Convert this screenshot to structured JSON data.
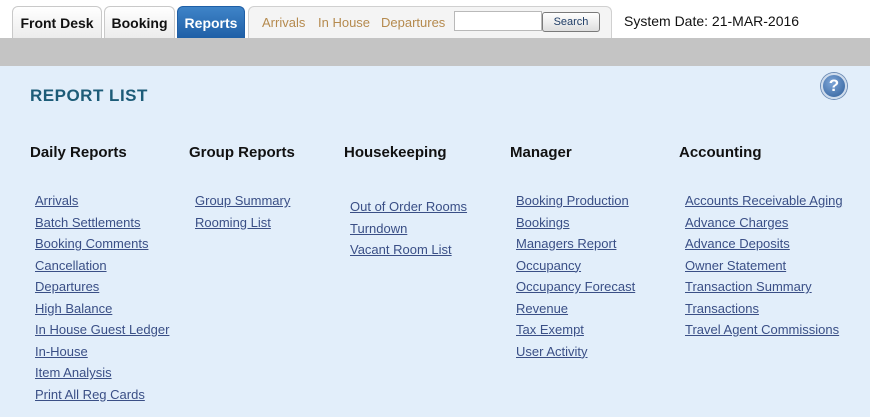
{
  "tabs": [
    {
      "label": "Front Desk",
      "active": false
    },
    {
      "label": "Booking",
      "active": false
    },
    {
      "label": "Reports",
      "active": true
    }
  ],
  "subnav": {
    "links": [
      "Arrivals",
      "In House",
      "Departures"
    ],
    "search_value": "",
    "search_button": "Search"
  },
  "system_date": "System Date: 21-MAR-2016",
  "panel": {
    "title": "REPORT LIST",
    "help_icon": "help-question-icon"
  },
  "columns": [
    {
      "heading": "Daily Reports",
      "items": [
        "Arrivals",
        "Batch Settlements",
        "Booking Comments",
        "Cancellation",
        "Departures",
        "High Balance",
        "In House Guest Ledger",
        "In-House",
        "Item Analysis",
        "Print All Reg Cards"
      ]
    },
    {
      "heading": "Group Reports",
      "items": [
        "Group Summary",
        "Rooming List"
      ]
    },
    {
      "heading": "Housekeeping",
      "items": [
        "Out of Order Rooms",
        "Turndown",
        "Vacant Room List"
      ]
    },
    {
      "heading": "Manager",
      "items": [
        "Booking Production",
        "Bookings",
        "Managers Report",
        "Occupancy",
        "Occupancy Forecast",
        "Revenue",
        "Tax Exempt",
        "User Activity"
      ]
    },
    {
      "heading": "Accounting",
      "items": [
        "Accounts Receivable Aging",
        "Advance Charges",
        "Advance Deposits",
        "Owner Statement",
        "Transaction Summary",
        "Transactions",
        "Travel Agent Commissions"
      ]
    }
  ],
  "colors": {
    "active_tab": "#1f5fa6",
    "panel_bg": "#e2eefa",
    "link": "#3a4f86",
    "title": "#1d5c78",
    "subnav_link": "#b58a4e"
  }
}
